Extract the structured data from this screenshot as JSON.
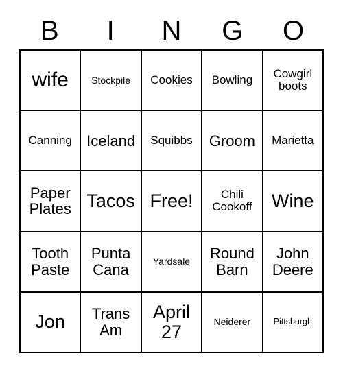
{
  "card": {
    "title": "BINGO",
    "header_letters": [
      "B",
      "I",
      "N",
      "G",
      "O"
    ],
    "free_space_label": "Free!",
    "colors": {
      "background": "#ffffff",
      "border": "#000000",
      "text": "#000000"
    },
    "grid": {
      "rows": 5,
      "columns": 5,
      "cells": [
        [
          {
            "text": "wife",
            "size": "fs-xl"
          },
          {
            "text": "Stockpile",
            "size": "fs-xs"
          },
          {
            "text": "Cookies",
            "size": "fs-sm"
          },
          {
            "text": "Bowling",
            "size": "fs-sm"
          },
          {
            "text": "Cowgirl boots",
            "size": "fs-sm"
          }
        ],
        [
          {
            "text": "Canning",
            "size": "fs-sm"
          },
          {
            "text": "Iceland",
            "size": "fs-md"
          },
          {
            "text": "Squibbs",
            "size": "fs-sm"
          },
          {
            "text": "Groom",
            "size": "fs-md"
          },
          {
            "text": "Marietta",
            "size": "fs-sm"
          }
        ],
        [
          {
            "text": "Paper Plates",
            "size": "fs-md"
          },
          {
            "text": "Tacos",
            "size": "fs-lg"
          },
          {
            "text": "Free!",
            "size": "fs-lg"
          },
          {
            "text": "Chili Cookoff",
            "size": "fs-sm"
          },
          {
            "text": "Wine",
            "size": "fs-lg"
          }
        ],
        [
          {
            "text": "Tooth Paste",
            "size": "fs-md"
          },
          {
            "text": "Punta Cana",
            "size": "fs-md"
          },
          {
            "text": "Yardsale",
            "size": "fs-xs"
          },
          {
            "text": "Round Barn",
            "size": "fs-md"
          },
          {
            "text": "John Deere",
            "size": "fs-md"
          }
        ],
        [
          {
            "text": "Jon",
            "size": "fs-lg"
          },
          {
            "text": "Trans Am",
            "size": "fs-md"
          },
          {
            "text": "April 27",
            "size": "fs-lg"
          },
          {
            "text": "Neiderer",
            "size": "fs-xs"
          },
          {
            "text": "Pittsburgh",
            "size": "fs-xxs"
          }
        ]
      ]
    }
  }
}
